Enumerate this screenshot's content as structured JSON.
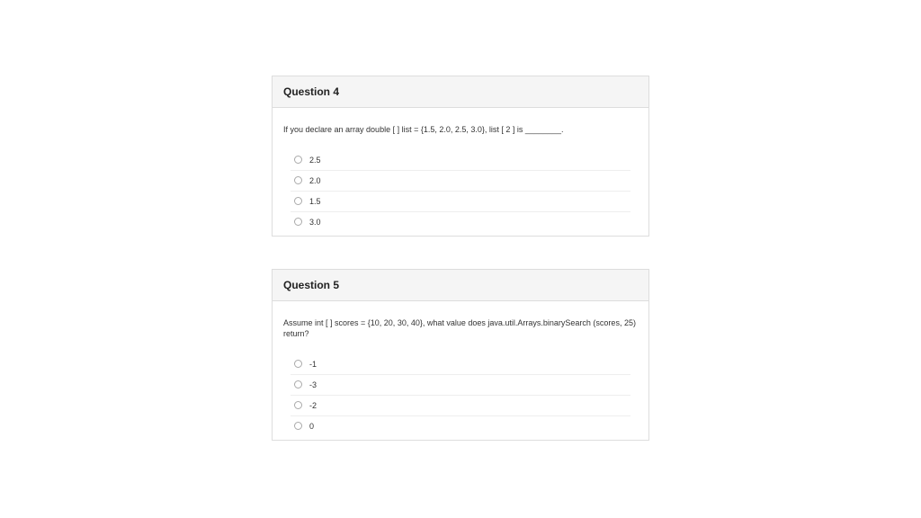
{
  "questions": [
    {
      "title": "Question 4",
      "prompt": "If you declare an array double [ ] list = {1.5, 2.0, 2.5, 3.0}, list [ 2 ] is ________.",
      "options": [
        "2.5",
        "2.0",
        "1.5",
        "3.0"
      ]
    },
    {
      "title": "Question 5",
      "prompt": "Assume int [ ] scores = {10, 20, 30, 40}, what value does java.util.Arrays.binarySearch (scores, 25) return?",
      "options": [
        "-1",
        "-3",
        "-2",
        "0"
      ]
    }
  ]
}
